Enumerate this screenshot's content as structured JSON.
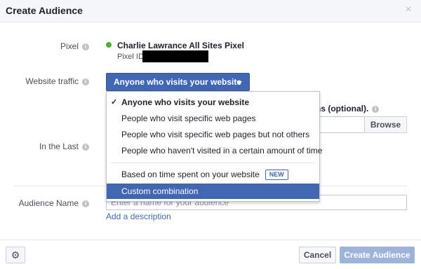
{
  "dialog": {
    "title": "Create Audience",
    "close_glyph": "×"
  },
  "pixel": {
    "label": "Pixel",
    "name": "Charlie Lawrance All Sites Pixel",
    "id_label": "Pixel ID",
    "status_color": "#42b72a"
  },
  "traffic": {
    "label": "Website traffic",
    "selected": "Anyone who visits your website",
    "menu": [
      {
        "label": "Anyone who visits your website",
        "selected": true
      },
      {
        "label": "People who visit specific web pages"
      },
      {
        "label": "People who visit specific web pages but not others"
      },
      {
        "label": "People who haven't visited in a certain amount of time"
      },
      {
        "label": "Based on time spent on your website",
        "badge": "NEW"
      },
      {
        "label": "Custom combination",
        "highlighted": true
      }
    ]
  },
  "background": {
    "domains_text": "ains (optional).",
    "browse_label": "Browse"
  },
  "in_the_last": {
    "label": "In the Last"
  },
  "audience_name": {
    "label": "Audience Name",
    "placeholder": "Enter a name for your audience",
    "add_description": "Add a description"
  },
  "footer": {
    "cancel_label": "Cancel",
    "create_label": "Create Audience",
    "settings_glyph": "⚙"
  },
  "colors": {
    "accent": "#4267b2",
    "header_bg": "#f6f7f9",
    "create_disabled": "#9cb4d8"
  }
}
